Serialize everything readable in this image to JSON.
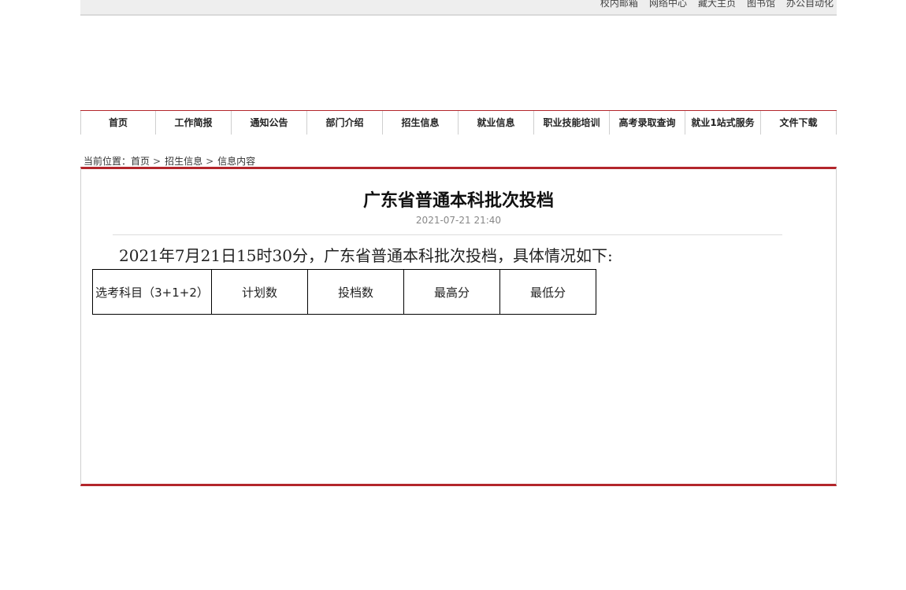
{
  "topbar": {
    "links": [
      "校内邮箱",
      "网络中心",
      "藏大主页",
      "图书馆",
      "办公自动化"
    ]
  },
  "nav": {
    "items": [
      "首页",
      "工作简报",
      "通知公告",
      "部门介绍",
      "招生信息",
      "就业信息",
      "职业技能培训",
      "高考录取查询",
      "就业1站式服务",
      "文件下载"
    ]
  },
  "breadcrumb": {
    "prefix": "当前位置：",
    "items": [
      "首页",
      "招生信息",
      "信息内容"
    ],
    "separator": ">"
  },
  "article": {
    "title": "广东省普通本科批次投档",
    "date": "2021-07-21 21:40",
    "intro": "2021年7月21日15时30分，广东省普通本科批次投档，具体情况如下:",
    "table": {
      "headers": [
        "选考科目（3+1+2）",
        "计划数",
        "投档数",
        "最高分",
        "最低分"
      ]
    }
  },
  "colors": {
    "accent": "#b3262b",
    "topbar_bg": "#eeeeee",
    "date_text": "#888888"
  }
}
